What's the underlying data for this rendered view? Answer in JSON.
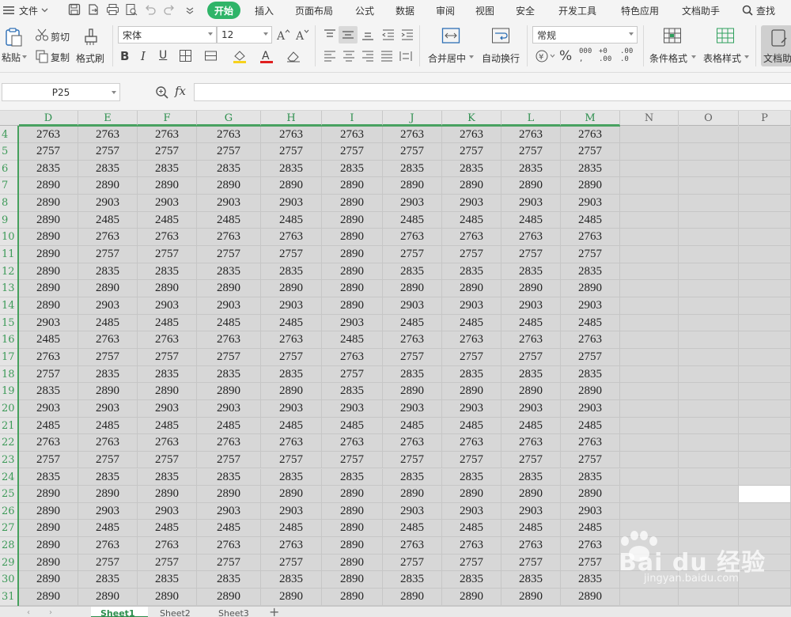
{
  "menu": {
    "file": "文件",
    "tabs": [
      "开始",
      "插入",
      "页面布局",
      "公式",
      "数据",
      "审阅",
      "视图",
      "安全",
      "开发工具",
      "特色应用",
      "文档助手"
    ],
    "search": "查找"
  },
  "ribbon": {
    "paste": "粘贴",
    "cut": "剪切",
    "copy": "复制",
    "format_painter": "格式刷",
    "font_name": "宋体",
    "font_size": "12",
    "merge_center": "合并居中",
    "wrap_text": "自动换行",
    "number_format": "常规",
    "conditional_format": "条件格式",
    "table_style": "表格样式",
    "doc_helper": "文档助"
  },
  "formula_bar": {
    "name_box": "P25",
    "fx": "fx",
    "content": ""
  },
  "sheet": {
    "columns": [
      "D",
      "E",
      "F",
      "G",
      "H",
      "I",
      "J",
      "K",
      "L",
      "M",
      "N",
      "O",
      "P"
    ],
    "selected_cell": "P25",
    "rows": [
      {
        "n": "4",
        "v": [
          "2763",
          "2763",
          "2763",
          "2763",
          "2763",
          "2763",
          "2763",
          "2763",
          "2763",
          "2763"
        ]
      },
      {
        "n": "5",
        "v": [
          "2757",
          "2757",
          "2757",
          "2757",
          "2757",
          "2757",
          "2757",
          "2757",
          "2757",
          "2757"
        ]
      },
      {
        "n": "6",
        "v": [
          "2835",
          "2835",
          "2835",
          "2835",
          "2835",
          "2835",
          "2835",
          "2835",
          "2835",
          "2835"
        ]
      },
      {
        "n": "7",
        "v": [
          "2890",
          "2890",
          "2890",
          "2890",
          "2890",
          "2890",
          "2890",
          "2890",
          "2890",
          "2890"
        ]
      },
      {
        "n": "8",
        "v": [
          "2890",
          "2903",
          "2903",
          "2903",
          "2903",
          "2890",
          "2903",
          "2903",
          "2903",
          "2903"
        ]
      },
      {
        "n": "9",
        "v": [
          "2890",
          "2485",
          "2485",
          "2485",
          "2485",
          "2890",
          "2485",
          "2485",
          "2485",
          "2485"
        ]
      },
      {
        "n": "10",
        "v": [
          "2890",
          "2763",
          "2763",
          "2763",
          "2763",
          "2890",
          "2763",
          "2763",
          "2763",
          "2763"
        ]
      },
      {
        "n": "11",
        "v": [
          "2890",
          "2757",
          "2757",
          "2757",
          "2757",
          "2890",
          "2757",
          "2757",
          "2757",
          "2757"
        ]
      },
      {
        "n": "12",
        "v": [
          "2890",
          "2835",
          "2835",
          "2835",
          "2835",
          "2890",
          "2835",
          "2835",
          "2835",
          "2835"
        ]
      },
      {
        "n": "13",
        "v": [
          "2890",
          "2890",
          "2890",
          "2890",
          "2890",
          "2890",
          "2890",
          "2890",
          "2890",
          "2890"
        ]
      },
      {
        "n": "14",
        "v": [
          "2890",
          "2903",
          "2903",
          "2903",
          "2903",
          "2890",
          "2903",
          "2903",
          "2903",
          "2903"
        ]
      },
      {
        "n": "15",
        "v": [
          "2903",
          "2485",
          "2485",
          "2485",
          "2485",
          "2903",
          "2485",
          "2485",
          "2485",
          "2485"
        ]
      },
      {
        "n": "16",
        "v": [
          "2485",
          "2763",
          "2763",
          "2763",
          "2763",
          "2485",
          "2763",
          "2763",
          "2763",
          "2763"
        ]
      },
      {
        "n": "17",
        "v": [
          "2763",
          "2757",
          "2757",
          "2757",
          "2757",
          "2763",
          "2757",
          "2757",
          "2757",
          "2757"
        ]
      },
      {
        "n": "18",
        "v": [
          "2757",
          "2835",
          "2835",
          "2835",
          "2835",
          "2757",
          "2835",
          "2835",
          "2835",
          "2835"
        ]
      },
      {
        "n": "19",
        "v": [
          "2835",
          "2890",
          "2890",
          "2890",
          "2890",
          "2835",
          "2890",
          "2890",
          "2890",
          "2890"
        ]
      },
      {
        "n": "20",
        "v": [
          "2903",
          "2903",
          "2903",
          "2903",
          "2903",
          "2903",
          "2903",
          "2903",
          "2903",
          "2903"
        ]
      },
      {
        "n": "21",
        "v": [
          "2485",
          "2485",
          "2485",
          "2485",
          "2485",
          "2485",
          "2485",
          "2485",
          "2485",
          "2485"
        ]
      },
      {
        "n": "22",
        "v": [
          "2763",
          "2763",
          "2763",
          "2763",
          "2763",
          "2763",
          "2763",
          "2763",
          "2763",
          "2763"
        ]
      },
      {
        "n": "23",
        "v": [
          "2757",
          "2757",
          "2757",
          "2757",
          "2757",
          "2757",
          "2757",
          "2757",
          "2757",
          "2757"
        ]
      },
      {
        "n": "24",
        "v": [
          "2835",
          "2835",
          "2835",
          "2835",
          "2835",
          "2835",
          "2835",
          "2835",
          "2835",
          "2835"
        ]
      },
      {
        "n": "25",
        "v": [
          "2890",
          "2890",
          "2890",
          "2890",
          "2890",
          "2890",
          "2890",
          "2890",
          "2890",
          "2890"
        ]
      },
      {
        "n": "26",
        "v": [
          "2890",
          "2903",
          "2903",
          "2903",
          "2903",
          "2890",
          "2903",
          "2903",
          "2903",
          "2903"
        ]
      },
      {
        "n": "27",
        "v": [
          "2890",
          "2485",
          "2485",
          "2485",
          "2485",
          "2890",
          "2485",
          "2485",
          "2485",
          "2485"
        ]
      },
      {
        "n": "28",
        "v": [
          "2890",
          "2763",
          "2763",
          "2763",
          "2763",
          "2890",
          "2763",
          "2763",
          "2763",
          "2763"
        ]
      },
      {
        "n": "29",
        "v": [
          "2890",
          "2757",
          "2757",
          "2757",
          "2757",
          "2890",
          "2757",
          "2757",
          "2757",
          "2757"
        ]
      },
      {
        "n": "30",
        "v": [
          "2890",
          "2835",
          "2835",
          "2835",
          "2835",
          "2890",
          "2835",
          "2835",
          "2835",
          "2835"
        ]
      },
      {
        "n": "31",
        "v": [
          "2890",
          "2890",
          "2890",
          "2890",
          "2890",
          "2890",
          "2890",
          "2890",
          "2890",
          "2890"
        ]
      }
    ]
  },
  "sheet_tabs": [
    "Sheet1",
    "Sheet2",
    "Sheet3"
  ],
  "watermark": {
    "brand": "Bai du 经验",
    "url": "jingyan.baidu.com"
  },
  "colors": {
    "accent": "#2fb468",
    "grid_bg": "#d7d7d7",
    "header_green": "#3d9a58"
  }
}
